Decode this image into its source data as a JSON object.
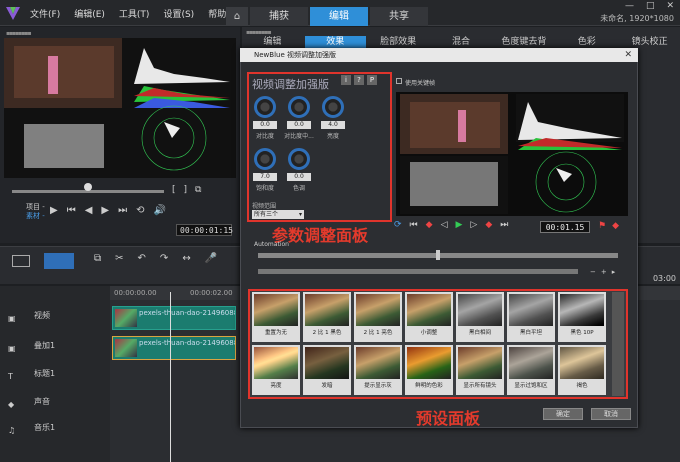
{
  "menu": [
    "文件(F)",
    "编辑(E)",
    "工具(T)",
    "设置(S)",
    "帮助(H)"
  ],
  "tabs": [
    {
      "label": "捕获"
    },
    {
      "label": "编辑"
    },
    {
      "label": "共享"
    }
  ],
  "project_info": "未命名, 1920*1080",
  "player": {
    "timecode": "00:00:01:15",
    "project_label": "项目 -",
    "clip_label": "素材 -"
  },
  "subtabs": [
    "编辑",
    "效果",
    "脸部效果",
    "混合",
    "色度键去背",
    "色彩",
    "镜头校正"
  ],
  "timeline": {
    "ruler": [
      "00:00:00.00",
      "00:00:02.00",
      "03:00"
    ],
    "clips": [
      "pexels-thuan-dao-2149608801-3",
      "pexels-thuan-dao-2149608801-3"
    ],
    "tracks": [
      "视频",
      "叠加1",
      "标题1",
      "声音",
      "音乐1"
    ]
  },
  "dialog": {
    "title": "NewBlue 视频调整加强版",
    "enhancer_title": "视频调整加强版",
    "info_buttons": [
      "i",
      "?",
      "P"
    ],
    "use_keyframes": "使用关键帧",
    "knobs": [
      {
        "label": "对比度",
        "value": "0.0"
      },
      {
        "label": "对比度中...",
        "value": "0.0"
      },
      {
        "label": "亮度",
        "value": "4.0"
      },
      {
        "label": "饱和度",
        "value": "7.0"
      },
      {
        "label": "色调",
        "value": "0.0"
      }
    ],
    "video_range_label": "视频范围",
    "video_range_value": "所有三个",
    "timecode": "00:01.15",
    "automation_label": "Automation",
    "presets": [
      "重置为无",
      "2 比 1 黑色",
      "2 比 1 亮色",
      "小调整",
      "黑白相间",
      "黑白平坦",
      "黑色 10P",
      "亮度",
      "发暗",
      "提示显示灰",
      "鲜明的色彩",
      "显示所有镜头",
      "显示过饱和区",
      "褐色"
    ],
    "buttons": {
      "ok": "确定",
      "cancel": "取消"
    }
  },
  "annotations": {
    "params_panel": "参数调整面板",
    "presets_panel": "预设面板"
  }
}
